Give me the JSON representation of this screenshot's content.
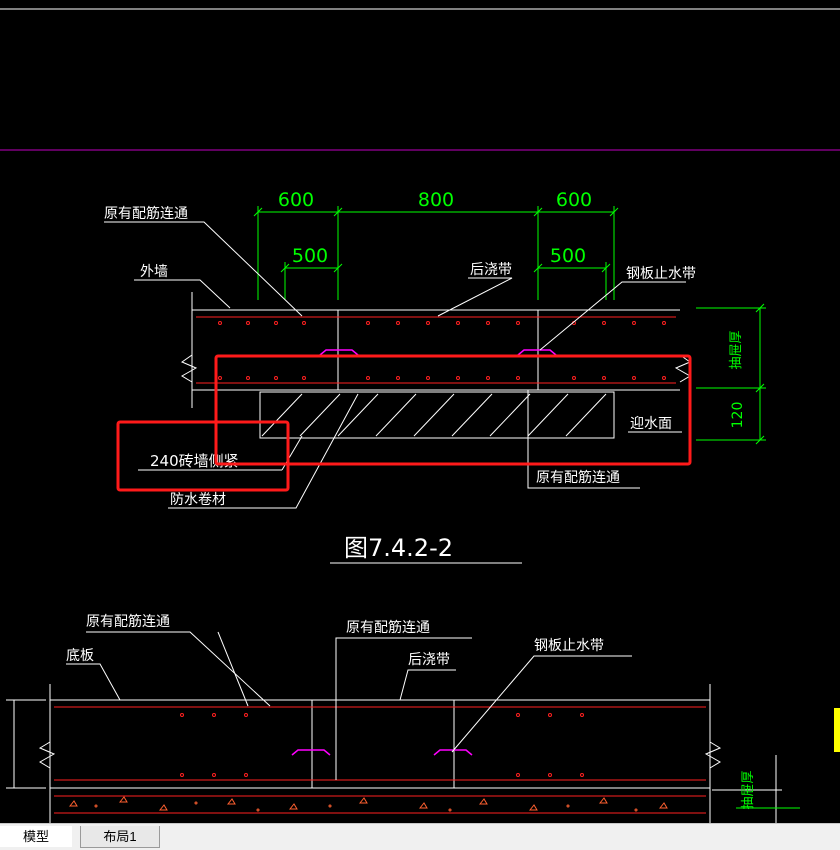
{
  "drawing": {
    "dimensions": {
      "d600_left": "600",
      "d800": "800",
      "d600_right": "600",
      "d500_left": "500",
      "d500_right": "500",
      "d120": "120",
      "thickness_top": "抽屉厚",
      "thickness_bottom": "抽屉厚"
    },
    "labels": {
      "original_rebar_top": "原有配筋连通",
      "outer_wall": "外墙",
      "post_cast_strip_top": "后浇带",
      "steel_waterstop_top": "钢板止水带",
      "water_facing": "迎水面",
      "brick_wall": "240砖墙侧紧",
      "original_rebar_right": "原有配筋连通",
      "waterproof_membrane": "防水卷材",
      "figure_title": "图7.4.2-2",
      "original_rebar_bottom_left": "原有配筋连通",
      "original_rebar_bottom_mid": "原有配筋连通",
      "floor_slab": "底板",
      "post_cast_strip_bottom": "后浇带",
      "steel_waterstop_bottom": "钢板止水带"
    }
  },
  "colors": {
    "background": "#000000",
    "linework": "#ffffff",
    "dimension": "#00ff00",
    "rebar": "#ff2020",
    "highlight_box": "#ff1a1a",
    "waterstop": "#ff00ff",
    "separator": "#c000c0"
  },
  "tabs": [
    {
      "label": "模型"
    },
    {
      "label": "布局1"
    }
  ]
}
